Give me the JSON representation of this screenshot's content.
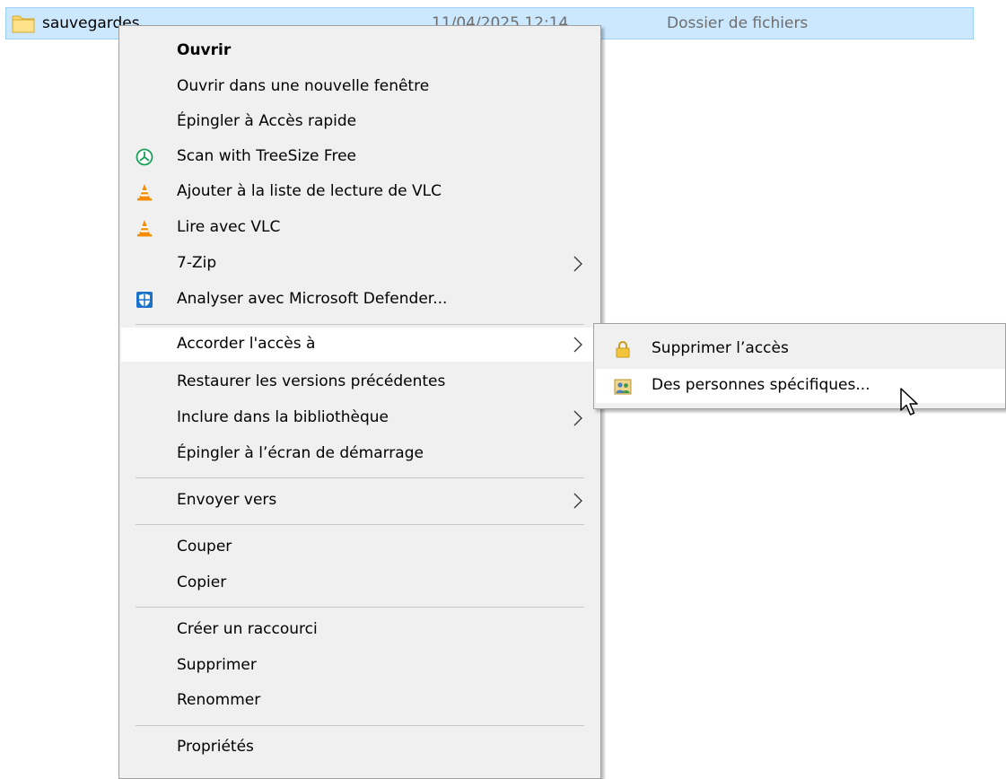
{
  "file_row": {
    "name": "sauvegardes",
    "date": "11/04/2025 12:14",
    "type": "Dossier de fichiers",
    "icon": "folder-icon"
  },
  "context_menu": {
    "items": [
      {
        "label": "Ouvrir",
        "bold": true
      },
      {
        "label": "Ouvrir dans une nouvelle fenêtre"
      },
      {
        "label": "Épingler à Accès rapide"
      },
      {
        "label": "Scan with TreeSize Free",
        "icon": "treesize-icon"
      },
      {
        "label": "Ajouter à la liste de lecture de VLC",
        "icon": "vlc-icon"
      },
      {
        "label": "Lire avec VLC",
        "icon": "vlc-icon"
      },
      {
        "label": "7-Zip",
        "submenu": true
      },
      {
        "label": "Analyser avec Microsoft Defender...",
        "icon": "defender-shield-icon"
      },
      {
        "label": "Accorder l'accès à",
        "submenu": true,
        "highlighted": true
      },
      {
        "label": "Restaurer les versions précédentes"
      },
      {
        "label": "Inclure dans la bibliothèque",
        "submenu": true
      },
      {
        "label": "Épingler à l’écran de démarrage"
      },
      {
        "label": "Envoyer vers",
        "submenu": true
      },
      {
        "label": "Couper"
      },
      {
        "label": "Copier"
      },
      {
        "label": "Créer un raccourci"
      },
      {
        "label": "Supprimer"
      },
      {
        "label": "Renommer"
      },
      {
        "label": "Propriétés"
      }
    ]
  },
  "submenu": {
    "items": [
      {
        "label": "Supprimer l’accès",
        "icon": "lock-icon"
      },
      {
        "label": "Des personnes spécifiques...",
        "icon": "users-icon",
        "highlighted": true
      }
    ]
  },
  "colors": {
    "selection_bg": "#cce8ff",
    "menu_bg": "#f0f0f0",
    "highlight_bg": "#ffffff"
  }
}
